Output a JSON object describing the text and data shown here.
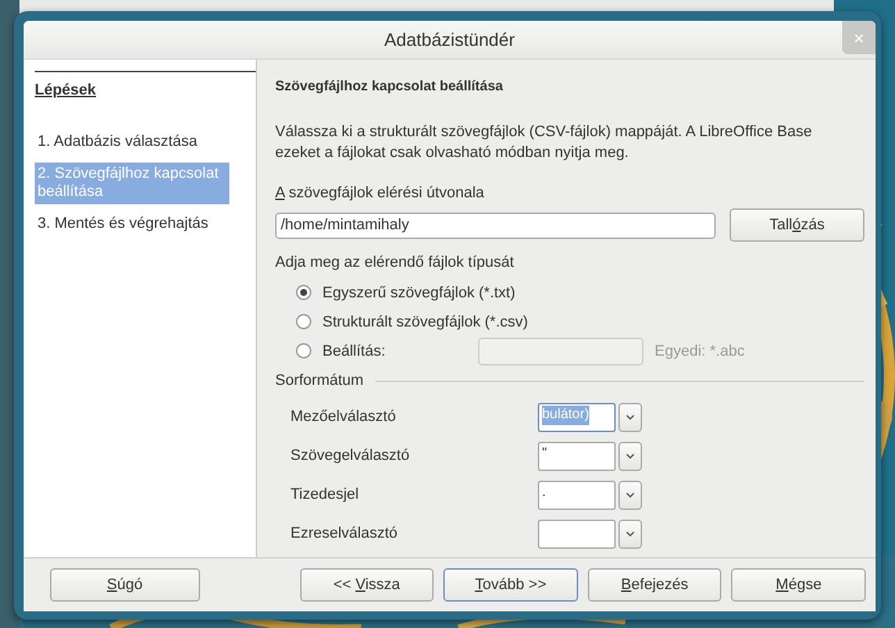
{
  "window": {
    "title": "Adatbázistündér",
    "close": "×"
  },
  "sidebar": {
    "heading": "Lépések",
    "steps": [
      {
        "label": "1. Adatbázis választása",
        "selected": false
      },
      {
        "label": "2. Szövegfájlhoz kapcsolat beállítása",
        "selected": true
      },
      {
        "label": "3. Mentés és végrehajtás",
        "selected": false
      }
    ]
  },
  "page": {
    "heading": "Szövegfájlhoz kapcsolat beállítása",
    "description": "Válassza ki a strukturált szövegfájlok (CSV-fájlok) mappáját. A LibreOffice Base ezeket a fájlokat csak olvasható módban nyitja meg.",
    "path_label": {
      "key": "A",
      "post": " szövegfájlok elérési útvonala"
    },
    "path_value": "/home/mintamihaly",
    "browse_button": {
      "pre": "Tall",
      "key": "ó",
      "post": "zás"
    },
    "type_label": "Adja meg az elérendő fájlok típusát",
    "types": [
      {
        "label": "Egyszerű szövegfájlok (*.txt)",
        "selected": true
      },
      {
        "label": "Strukturált szövegfájlok (*.csv)",
        "selected": false
      },
      {
        "label": "Beállítás:",
        "selected": false
      }
    ],
    "custom_field": {
      "disabled": true
    },
    "custom_hint": "Egyedi: *.abc",
    "row_format": {
      "title": "Sorformátum",
      "rows": [
        {
          "label": "Mezőelválasztó",
          "value": "bulátor)",
          "selected": true
        },
        {
          "label": "Szövegelválasztó",
          "value": "\"",
          "selected": false
        },
        {
          "label": "Tizedesjel",
          "value": ".",
          "selected": false
        },
        {
          "label": "Ezreselválasztó",
          "value": "",
          "selected": false
        }
      ]
    }
  },
  "buttons": [
    {
      "key": "S",
      "post": "úgó",
      "kind": "help",
      "default": false
    },
    {
      "pre": "<< ",
      "key": "V",
      "post": "issza",
      "kind": "nav",
      "default": false
    },
    {
      "key": "T",
      "post": "ovább >>",
      "kind": "nav",
      "default": true
    },
    {
      "key": "B",
      "post": "efejezés",
      "kind": "nav",
      "default": false
    },
    {
      "key": "M",
      "post": "égse",
      "kind": "nav",
      "default": false
    }
  ]
}
